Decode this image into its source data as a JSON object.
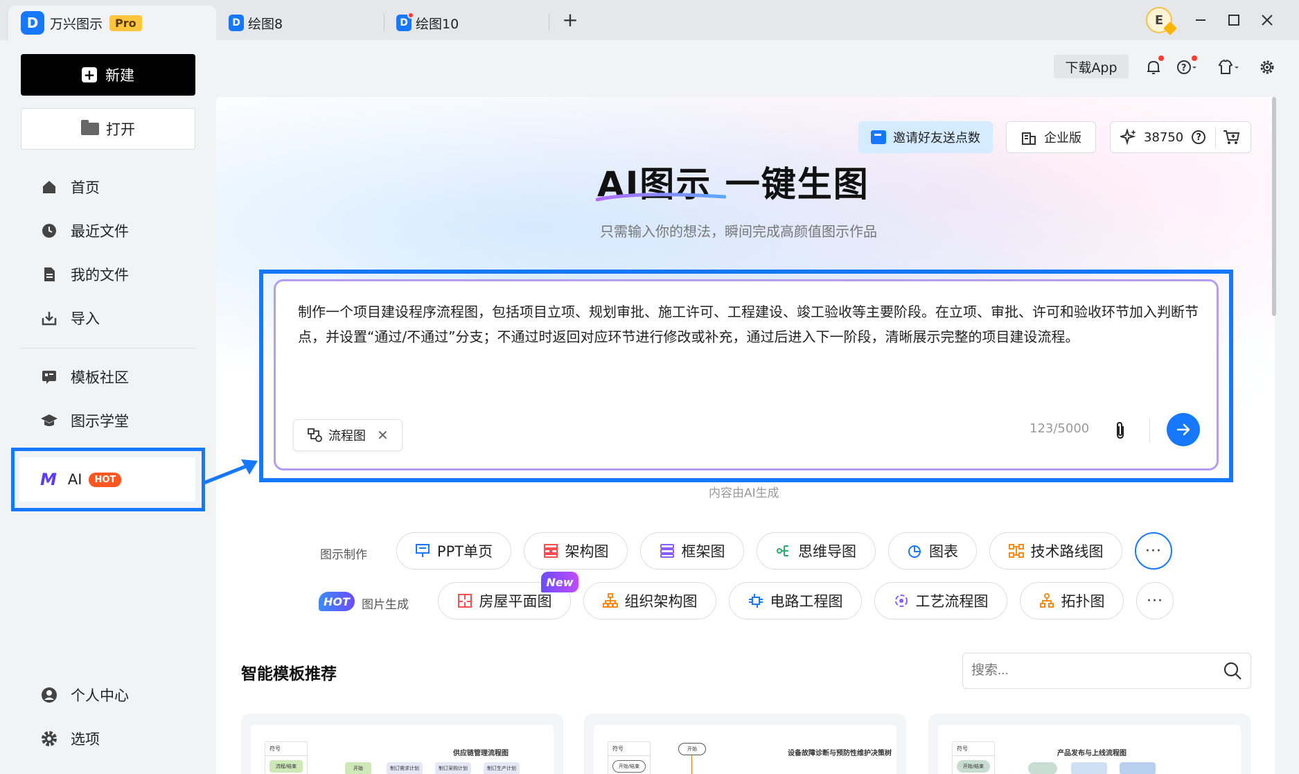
{
  "titlebar": {
    "app_name": "万兴图示",
    "pro_badge": "Pro",
    "tabs": [
      {
        "label": "绘图8"
      },
      {
        "label": "绘图10"
      }
    ],
    "new_tab": "+",
    "avatar_letter": "E"
  },
  "sidebar": {
    "new_label": "新建",
    "open_label": "打开",
    "items": [
      {
        "label": "首页",
        "icon": "home-icon"
      },
      {
        "label": "最近文件",
        "icon": "clock-icon"
      },
      {
        "label": "我的文件",
        "icon": "file-icon"
      },
      {
        "label": "导入",
        "icon": "import-icon"
      },
      {
        "label": "模板社区",
        "icon": "community-icon"
      },
      {
        "label": "图示学堂",
        "icon": "graduation-cap-icon"
      }
    ],
    "ai_label": "AI",
    "ai_badge": "HOT",
    "bottom_items": [
      {
        "label": "个人中心",
        "icon": "user-icon"
      },
      {
        "label": "选项",
        "icon": "gear-icon"
      }
    ]
  },
  "topbar": {
    "download_app": "下载App"
  },
  "hero": {
    "invite": "邀请好友送点数",
    "enterprise": "企业版",
    "points": "38750",
    "title": "AI图示 一键生图",
    "subtitle": "只需输入你的想法，瞬间完成高颜值图示作品"
  },
  "prompt": {
    "text": "制作一个项目建设程序流程图，包括项目立项、规划审批、施工许可、工程建设、竣工验收等主要阶段。在立项、审批、许可和验收环节加入判断节点，并设置“通过/不通过”分支；不通过时返回对应环节进行修改或补充，通过后进入下一阶段，清晰展示完整的项目建设流程。",
    "chip": "流程图",
    "count": "123/5000",
    "note": "内容由AI生成"
  },
  "categories": {
    "row1_label": "图示制作",
    "row1": [
      "PPT单页",
      "架构图",
      "框架图",
      "思维导图",
      "图表",
      "技术路线图"
    ],
    "row2_badge": "HOT",
    "row2_label": "图片生成",
    "row2_new": "New",
    "row2": [
      "房屋平面图",
      "组织架构图",
      "电路工程图",
      "工艺流程图",
      "拓扑图"
    ],
    "more": "···"
  },
  "templates": {
    "section_title": "智能模板推荐",
    "search_placeholder": "搜索...",
    "cards": [
      {
        "title": "供应链管理流程图",
        "legend": "符号",
        "legend_item": "流程/结束",
        "n1": "开始",
        "n2": "制订需求计划",
        "n3": "制订采购计划",
        "n4": "制订生产计划"
      },
      {
        "title": "设备故障诊断与预防性维护决策树",
        "legend": "符号",
        "legend_item": "开始/结束",
        "n1": "开始"
      },
      {
        "title": "产品发布与上线流程图",
        "legend": "符号",
        "legend_item": "开始/结束"
      }
    ]
  },
  "colors": {
    "accent": "#1677ff",
    "hot": "#ff5722",
    "prompt_border": "#b59cf5"
  }
}
